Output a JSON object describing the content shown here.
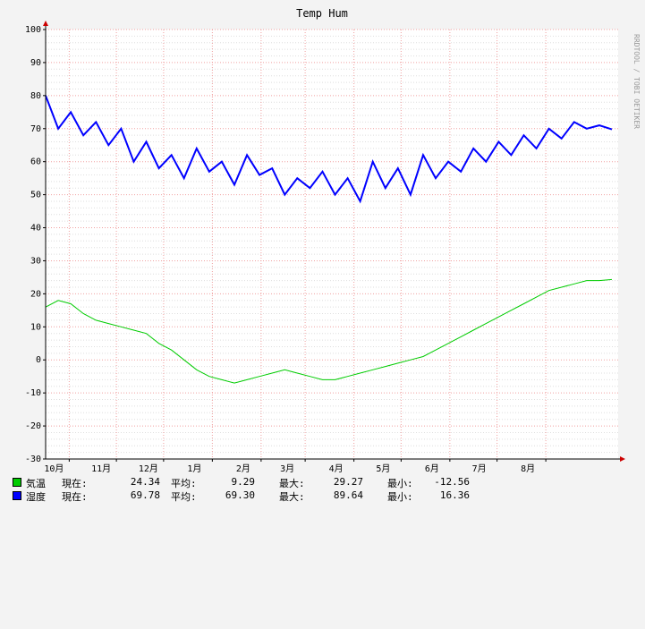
{
  "chart_data": {
    "type": "line",
    "title": "Temp Hum",
    "watermark": "RRDTOOL / TOBI OETIKER",
    "ylim": [
      -30,
      100
    ],
    "yticks": [
      100,
      90,
      80,
      70,
      60,
      50,
      40,
      30,
      20,
      10,
      0,
      -10,
      -20,
      -30
    ],
    "xlim": [
      0,
      364
    ],
    "xticks": [
      {
        "label": "10月",
        "x": 15
      },
      {
        "label": "11月",
        "x": 45
      },
      {
        "label": "12月",
        "x": 75
      },
      {
        "label": "1月",
        "x": 106
      },
      {
        "label": "2月",
        "x": 137
      },
      {
        "label": "3月",
        "x": 165
      },
      {
        "label": "4月",
        "x": 196
      },
      {
        "label": "5月",
        "x": 226
      },
      {
        "label": "6月",
        "x": 257
      },
      {
        "label": "7月",
        "x": 287
      },
      {
        "label": "8月",
        "x": 318
      }
    ],
    "grid": true,
    "legend_position": "bottom",
    "series": [
      {
        "name": "気温",
        "color": "#00cc00",
        "x": [
          0,
          8,
          16,
          24,
          32,
          40,
          48,
          56,
          64,
          72,
          80,
          88,
          96,
          104,
          112,
          120,
          128,
          136,
          144,
          152,
          160,
          168,
          176,
          184,
          192,
          200,
          208,
          216,
          224,
          232,
          240,
          248,
          256,
          264,
          272,
          280,
          288,
          296,
          304,
          312,
          320,
          328,
          336,
          344,
          352,
          360
        ],
        "values": [
          16,
          18,
          17,
          14,
          12,
          11,
          10,
          9,
          8,
          5,
          3,
          0,
          -3,
          -5,
          -6,
          -7,
          -6,
          -5,
          -4,
          -3,
          -4,
          -5,
          -6,
          -6,
          -5,
          -4,
          -3,
          -2,
          -1,
          0,
          1,
          3,
          5,
          7,
          9,
          11,
          13,
          15,
          17,
          19,
          21,
          22,
          23,
          24,
          24,
          24.34
        ]
      },
      {
        "name": "湿度",
        "color": "#0000ff",
        "x": [
          0,
          8,
          16,
          24,
          32,
          40,
          48,
          56,
          64,
          72,
          80,
          88,
          96,
          104,
          112,
          120,
          128,
          136,
          144,
          152,
          160,
          168,
          176,
          184,
          192,
          200,
          208,
          216,
          224,
          232,
          240,
          248,
          256,
          264,
          272,
          280,
          288,
          296,
          304,
          312,
          320,
          328,
          336,
          344,
          352,
          360
        ],
        "values": [
          80,
          70,
          75,
          68,
          72,
          65,
          70,
          60,
          66,
          58,
          62,
          55,
          64,
          57,
          60,
          53,
          62,
          56,
          58,
          50,
          55,
          52,
          57,
          50,
          55,
          48,
          60,
          52,
          58,
          50,
          62,
          55,
          60,
          57,
          64,
          60,
          66,
          62,
          68,
          64,
          70,
          67,
          72,
          70,
          71,
          69.78
        ]
      }
    ],
    "legend": [
      {
        "name": "気温",
        "color": "#00cc00",
        "cur_label": "現在:",
        "cur": "24.34",
        "avg_label": "平均:",
        "avg": "9.29",
        "max_label": "最大:",
        "max": "29.27",
        "min_label": "最小:",
        "min": "-12.56"
      },
      {
        "name": "湿度",
        "color": "#0000ff",
        "cur_label": "現在:",
        "cur": "69.78",
        "avg_label": "平均:",
        "avg": "69.30",
        "max_label": "最大:",
        "max": "89.64",
        "min_label": "最小:",
        "min": "16.36"
      }
    ]
  }
}
